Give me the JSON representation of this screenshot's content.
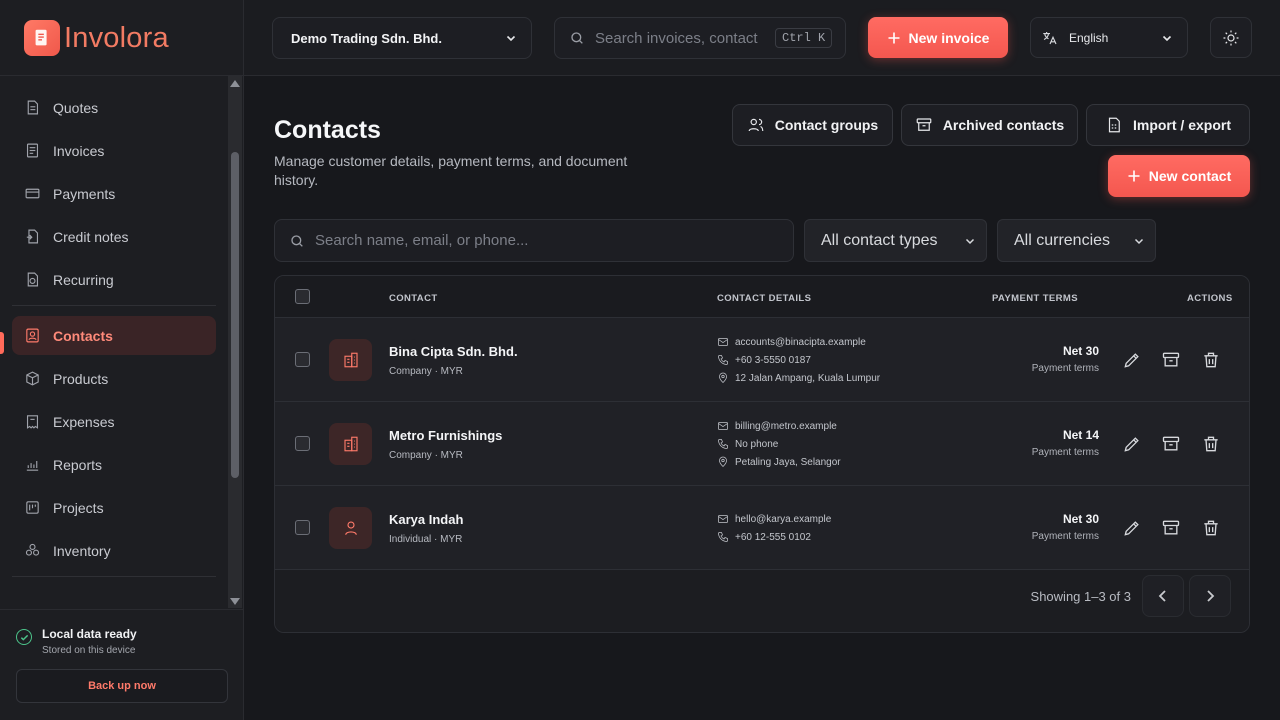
{
  "brand": {
    "name": "Involora",
    "accent": "#ff6a5a"
  },
  "sidebar": {
    "groups": [
      [
        {
          "label": "Quotes",
          "icon": "quotes-icon"
        },
        {
          "label": "Invoices",
          "icon": "invoices-icon"
        },
        {
          "label": "Payments",
          "icon": "payments-icon"
        },
        {
          "label": "Credit notes",
          "icon": "credit-notes-icon"
        },
        {
          "label": "Recurring",
          "icon": "recurring-icon"
        }
      ],
      [
        {
          "label": "Contacts",
          "icon": "contacts-icon",
          "active": true
        },
        {
          "label": "Products",
          "icon": "products-icon"
        },
        {
          "label": "Expenses",
          "icon": "expenses-icon"
        },
        {
          "label": "Reports",
          "icon": "reports-icon"
        },
        {
          "label": "Projects",
          "icon": "projects-icon"
        },
        {
          "label": "Inventory",
          "icon": "inventory-icon"
        }
      ]
    ],
    "status": {
      "title": "Local data ready",
      "subtitle": "Stored on this device"
    },
    "backup_label": "Back up now"
  },
  "topbar": {
    "organization": "Demo Trading Sdn. Bhd.",
    "search": {
      "placeholder": "Search invoices, contact",
      "shortcut": "Ctrl K"
    },
    "new_invoice_label": "New invoice",
    "language": "English"
  },
  "page": {
    "title": "Contacts",
    "subtitle": "Manage customer details, payment terms, and document history.",
    "actions": {
      "contact_groups": "Contact groups",
      "archived_contacts": "Archived contacts",
      "import_export": "Import / export",
      "new_contact": "New contact"
    },
    "filters": {
      "search_placeholder": "Search name, email, or phone...",
      "contact_type": "All contact types",
      "currency": "All currencies"
    },
    "table": {
      "headers": {
        "contact": "CONTACT",
        "details": "CONTACT DETAILS",
        "terms": "PAYMENT TERMS",
        "actions": "ACTIONS"
      },
      "rows": [
        {
          "name": "Bina Cipta Sdn. Bhd.",
          "meta": "Company · MYR",
          "kind": "company",
          "email": "accounts@binacipta.example",
          "phone": "+60 3-5550 0187",
          "address": "12 Jalan Ampang, Kuala Lumpur",
          "terms": "Net 30",
          "terms_label": "Payment terms"
        },
        {
          "name": "Metro Furnishings",
          "meta": "Company · MYR",
          "kind": "company",
          "email": "billing@metro.example",
          "phone": "No phone",
          "address": "Petaling Jaya, Selangor",
          "terms": "Net 14",
          "terms_label": "Payment terms"
        },
        {
          "name": "Karya Indah",
          "meta": "Individual · MYR",
          "kind": "individual",
          "email": "hello@karya.example",
          "phone": "+60 12-555 0102",
          "address": "",
          "terms": "Net 30",
          "terms_label": "Payment terms"
        }
      ],
      "showing": "Showing 1–3 of 3"
    }
  }
}
